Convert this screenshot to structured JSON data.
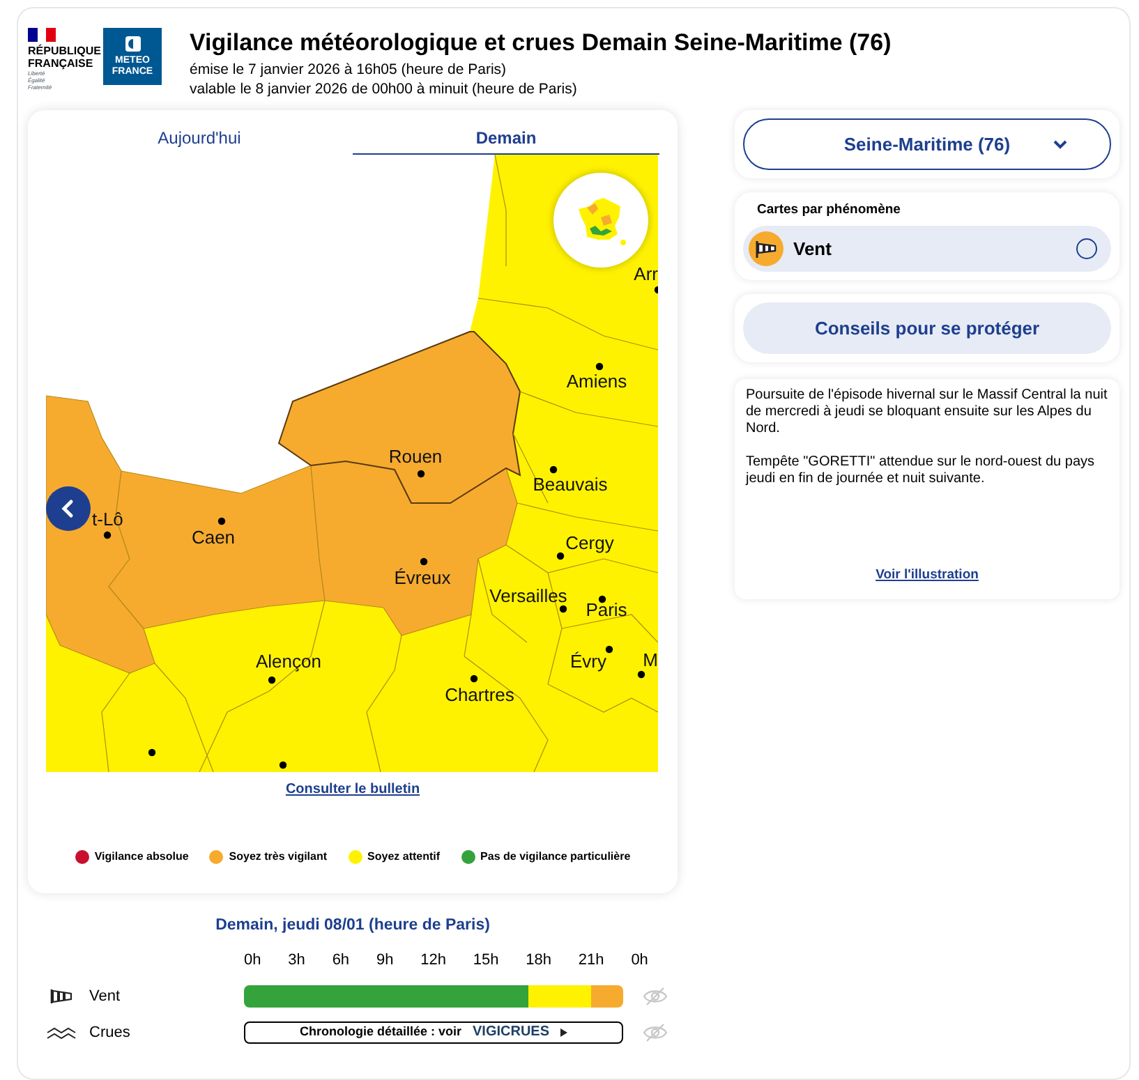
{
  "header": {
    "gov_logo": [
      "RÉPUBLIQUE",
      "FRANÇAISE"
    ],
    "gov_motto": [
      "Liberté",
      "Égalité",
      "Fraternité"
    ],
    "meteo_logo": [
      "METEO",
      "FRANCE"
    ],
    "title": "Vigilance météorologique et crues Demain Seine-Maritime (76)",
    "issued": "émise le 7 janvier 2026 à 16h05 (heure de Paris)",
    "valid": "valable le 8 janvier 2026 de 00h00 à minuit (heure de Paris)"
  },
  "tabs": [
    {
      "label": "Aujourd'hui",
      "selected": false
    },
    {
      "label": "Demain",
      "selected": true
    }
  ],
  "map": {
    "cities": [
      "Arr",
      "Amiens",
      "Rouen",
      "Beauvais",
      "t-Lô",
      "Caen",
      "Cergy",
      "Évreux",
      "Versailles",
      "Paris",
      "Alençon",
      "Évry",
      "M",
      "Chartres"
    ]
  },
  "bulletin_link": "Consulter le bulletin",
  "legend": [
    {
      "label": "Vigilance absolue",
      "color": "#c8102e"
    },
    {
      "label": "Soyez très vigilant",
      "color": "#f6ab2f"
    },
    {
      "label": "Soyez attentif",
      "color": "#fff200"
    },
    {
      "label": "Pas de vigilance particulière",
      "color": "#34a33b"
    }
  ],
  "department_select": {
    "value": "Seine-Maritime (76)"
  },
  "phenomena": {
    "heading": "Cartes par phénomène",
    "items": [
      {
        "label": "Vent",
        "selected": false
      }
    ]
  },
  "advice_button": "Conseils pour se protéger",
  "bulletin_text": {
    "paragraphs": [
      "Poursuite de l'épisode hivernal sur le Massif Central la nuit de mercredi à jeudi se bloquant ensuite sur les Alpes du Nord.",
      "Tempête \"GORETTI\" attendue sur le nord-ouest du pays jeudi en fin de journée et nuit suivante."
    ],
    "link": "Voir l'illustration"
  },
  "timeline": {
    "heading": "Demain, jeudi 08/01 (heure de Paris)",
    "hours": [
      "0h",
      "3h",
      "6h",
      "9h",
      "12h",
      "15h",
      "18h",
      "21h",
      "0h"
    ],
    "rows": [
      {
        "kind": "bar",
        "label": "Vent",
        "hourly": [
          {
            "color": "#34a33b"
          },
          {
            "color": "#34a33b"
          },
          {
            "color": "#34a33b"
          },
          {
            "color": "#34a33b"
          },
          {
            "color": "#34a33b"
          },
          {
            "color": "#34a33b"
          },
          {
            "color": "#34a33b"
          },
          {
            "color": "#34a33b"
          },
          {
            "color": "#34a33b"
          },
          {
            "color": "#34a33b"
          },
          {
            "color": "#34a33b"
          },
          {
            "color": "#34a33b"
          },
          {
            "color": "#34a33b"
          },
          {
            "color": "#34a33b"
          },
          {
            "color": "#34a33b"
          },
          {
            "color": "#34a33b"
          },
          {
            "color": "#34a33b"
          },
          {
            "color": "#34a33b"
          },
          {
            "color": "#fff200"
          },
          {
            "color": "#fff200"
          },
          {
            "color": "#fff200"
          },
          {
            "color": "#fff200"
          },
          {
            "color": "#f6ab2f"
          },
          {
            "color": "#f6ab2f"
          }
        ]
      },
      {
        "kind": "link",
        "label": "Crues",
        "text": "Chronologie détaillée : voir",
        "brand": "VIGICRUES"
      }
    ]
  }
}
